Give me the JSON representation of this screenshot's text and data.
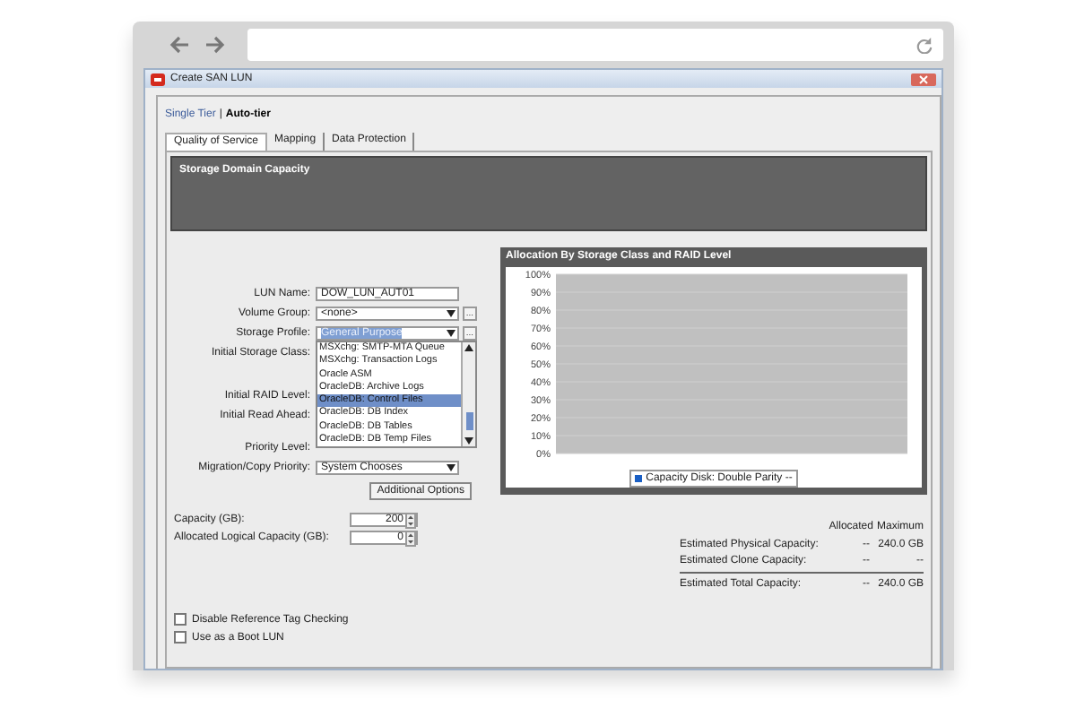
{
  "window": {
    "title": "Create SAN LUN"
  },
  "mode_switch": [
    {
      "label": "Single Tier",
      "selected": false
    },
    {
      "label": "Auto-tier",
      "selected": true
    }
  ],
  "mode_separator": "|",
  "tabs": [
    {
      "label": "Quality of Service",
      "selected": true
    },
    {
      "label": "Mapping",
      "selected": false
    },
    {
      "label": "Data Protection",
      "selected": false
    }
  ],
  "storage_panel": {
    "title": "Storage Domain Capacity"
  },
  "form": {
    "fields": [
      {
        "kind": "text",
        "label": "LUN Name:",
        "value": "DOW_LUN_AUT01"
      },
      {
        "kind": "select",
        "label": "Volume Group:",
        "value": "<none>",
        "browse_button": "..."
      },
      {
        "kind": "select",
        "label": "Storage Profile:",
        "value": "General Purpose",
        "browse_button": "...",
        "open": true,
        "options": [
          {
            "label": "MSXchg: SMTP-MTA Queue",
            "selected": false
          },
          {
            "label": "MSXchg: Transaction Logs",
            "selected": false
          },
          {
            "label": "Oracle ASM",
            "selected": false
          },
          {
            "label": "OracleDB: Archive Logs",
            "selected": false
          },
          {
            "label": "OracleDB: Control Files",
            "selected": true
          },
          {
            "label": "OracleDB: DB Index",
            "selected": false
          },
          {
            "label": "OracleDB: DB Tables",
            "selected": false
          },
          {
            "label": "OracleDB: DB Temp Files",
            "selected": false
          }
        ]
      },
      {
        "kind": "covered",
        "label": "Initial Storage Class:"
      },
      {
        "kind": "covered",
        "label": "Initial RAID Level:"
      },
      {
        "kind": "covered",
        "label": "Initial Read Ahead:"
      },
      {
        "kind": "covered",
        "label": "Priority Level:"
      },
      {
        "kind": "select",
        "label": "Migration/Copy Priority:",
        "value": "System Chooses"
      }
    ],
    "options_button": "Additional Options"
  },
  "chart": {
    "title": "Allocation By Storage Class and RAID Level",
    "chart_data": {
      "type": "bar",
      "grid": true,
      "ylim": [
        0,
        100
      ],
      "yticks": [
        {
          "value": 0,
          "label": "0%"
        },
        {
          "value": 10,
          "label": "10%"
        },
        {
          "value": 20,
          "label": "20%"
        },
        {
          "value": 30,
          "label": "30%"
        },
        {
          "value": 40,
          "label": "40%"
        },
        {
          "value": 50,
          "label": "50%"
        },
        {
          "value": 60,
          "label": "60%"
        },
        {
          "value": 70,
          "label": "70%"
        },
        {
          "value": 80,
          "label": "80%"
        },
        {
          "value": 90,
          "label": "90%"
        },
        {
          "value": 100,
          "label": "100%"
        }
      ],
      "series": [
        {
          "name": "Capacity Disk: Double Parity --",
          "color": "#1a5fc4",
          "values": [
            0
          ]
        }
      ]
    }
  },
  "capacity": [
    {
      "label": "Capacity (GB):",
      "value": "200"
    },
    {
      "label": "Allocated Logical Capacity (GB):",
      "value": "0"
    }
  ],
  "summary": {
    "columns": [
      "Allocated",
      "Maximum"
    ],
    "rows": [
      {
        "label": "Estimated Physical Capacity:",
        "allocated": "--",
        "maximum": "240.0 GB",
        "total": false
      },
      {
        "label": "Estimated Clone Capacity:",
        "allocated": "--",
        "maximum": "--",
        "total": false
      },
      {
        "label": "Estimated Total Capacity:",
        "allocated": "--",
        "maximum": "240.0 GB",
        "total": true
      }
    ]
  },
  "checkboxes": [
    {
      "label": "Disable Reference Tag Checking",
      "checked": false
    },
    {
      "label": "Use as a Boot LUN",
      "checked": false
    }
  ]
}
